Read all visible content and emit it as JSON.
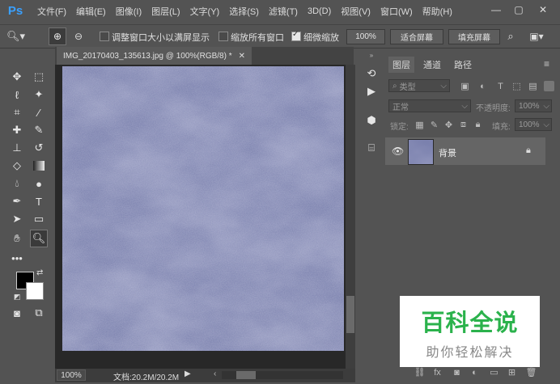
{
  "app": {
    "logo": "Ps"
  },
  "menu": [
    "文件(F)",
    "编辑(E)",
    "图像(I)",
    "图层(L)",
    "文字(Y)",
    "选择(S)",
    "滤镜(T)",
    "3D(D)",
    "视图(V)",
    "窗口(W)",
    "帮助(H)"
  ],
  "options": {
    "resize_windows": "调整窗口大小以满屏显示",
    "zoom_all": "缩放所有窗口",
    "scrubby_zoom": "细微缩放",
    "zoom_value": "100%",
    "fit_screen": "适合屏幕",
    "fill_screen": "填充屏幕",
    "resize_checked": false,
    "zoom_all_checked": false,
    "scrubby_checked": true
  },
  "document": {
    "tab_title": "IMG_20170403_135613.jpg @ 100%(RGB/8) *",
    "zoom": "100%",
    "doc_info": "文档:20.2M/20.2M"
  },
  "layers_panel": {
    "tabs": [
      "图层",
      "通道",
      "路径"
    ],
    "kind_placeholder": "类型",
    "blend_mode": "正常",
    "opacity_label": "不透明度:",
    "opacity_value": "100%",
    "lock_label": "锁定:",
    "fill_label": "填充:",
    "fill_value": "100%",
    "layers": [
      {
        "name": "背景",
        "visible": true,
        "locked": true
      }
    ]
  },
  "watermark": {
    "title": "百科全说",
    "subtitle": "助你轻松解决"
  },
  "colors": {
    "accent": "#3aa0ff",
    "canvas_texture": "#6a6f9a",
    "watermark_green": "#2bb24c"
  }
}
